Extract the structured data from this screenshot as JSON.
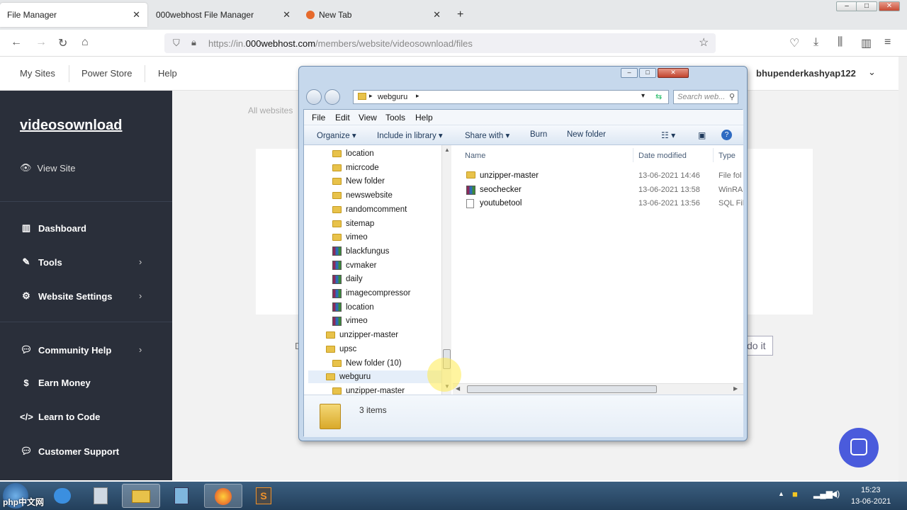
{
  "browser": {
    "tabs": [
      {
        "label": "File Manager"
      },
      {
        "label": "000webhost File Manager"
      },
      {
        "label": "New Tab"
      }
    ],
    "url_prefix": "https://in.",
    "url_host": "000webhost.com",
    "url_path": "/members/website/videosownload/files"
  },
  "site_header": {
    "links": [
      "My Sites",
      "Power Store",
      "Help"
    ],
    "username": "bhupenderkashyap122"
  },
  "sidebar": {
    "site_name": "videosownload",
    "view_site": "View Site",
    "items": [
      {
        "label": "Dashboard",
        "icon": "chart-icon"
      },
      {
        "label": "Tools",
        "icon": "wrench-icon"
      },
      {
        "label": "Website Settings",
        "icon": "gear-icon"
      },
      {
        "label": "Community Help",
        "icon": "chat-icon"
      },
      {
        "label": "Earn Money",
        "icon": "money-icon"
      },
      {
        "label": "Learn to Code",
        "icon": "code-icon"
      },
      {
        "label": "Customer Support",
        "icon": "support-icon"
      }
    ]
  },
  "main": {
    "breadcrumb_partial": "All websites",
    "button_partial": "do it",
    "left_partial": "D"
  },
  "explorer": {
    "address": "webguru",
    "search_placeholder": "Search web...",
    "menu": [
      "File",
      "Edit",
      "View",
      "Tools",
      "Help"
    ],
    "commands": [
      "Organize",
      "Include in library",
      "Share with",
      "Burn",
      "New folder"
    ],
    "tree": [
      {
        "label": "location",
        "type": "folder"
      },
      {
        "label": "micrcode",
        "type": "folder"
      },
      {
        "label": "New folder",
        "type": "folder"
      },
      {
        "label": "newswebsite",
        "type": "folder"
      },
      {
        "label": "randomcomment",
        "type": "folder"
      },
      {
        "label": "sitemap",
        "type": "folder"
      },
      {
        "label": "vimeo",
        "type": "folder"
      },
      {
        "label": "blackfungus",
        "type": "rar"
      },
      {
        "label": "cvmaker",
        "type": "rar"
      },
      {
        "label": "daily",
        "type": "rar"
      },
      {
        "label": "imagecompressor",
        "type": "rar"
      },
      {
        "label": "location",
        "type": "rar"
      },
      {
        "label": "vimeo",
        "type": "rar"
      },
      {
        "label": "unzipper-master",
        "type": "folder"
      },
      {
        "label": "upsc",
        "type": "folder"
      },
      {
        "label": "New folder (10)",
        "type": "folder"
      },
      {
        "label": "webguru",
        "type": "folder"
      },
      {
        "label": "unzipper-master",
        "type": "folder"
      }
    ],
    "columns": [
      "Name",
      "Date modified",
      "Type"
    ],
    "files": [
      {
        "name": "unzipper-master",
        "date": "13-06-2021 14:46",
        "type": "File fol",
        "kind": "folder"
      },
      {
        "name": "seochecker",
        "date": "13-06-2021 13:58",
        "type": "WinRA",
        "kind": "rar"
      },
      {
        "name": "youtubetool",
        "date": "13-06-2021 13:56",
        "type": "SQL Fil",
        "kind": "sql"
      }
    ],
    "status": "3 items"
  },
  "taskbar": {
    "time": "15:23",
    "date": "13-06-2021"
  },
  "watermark": "php中文网"
}
